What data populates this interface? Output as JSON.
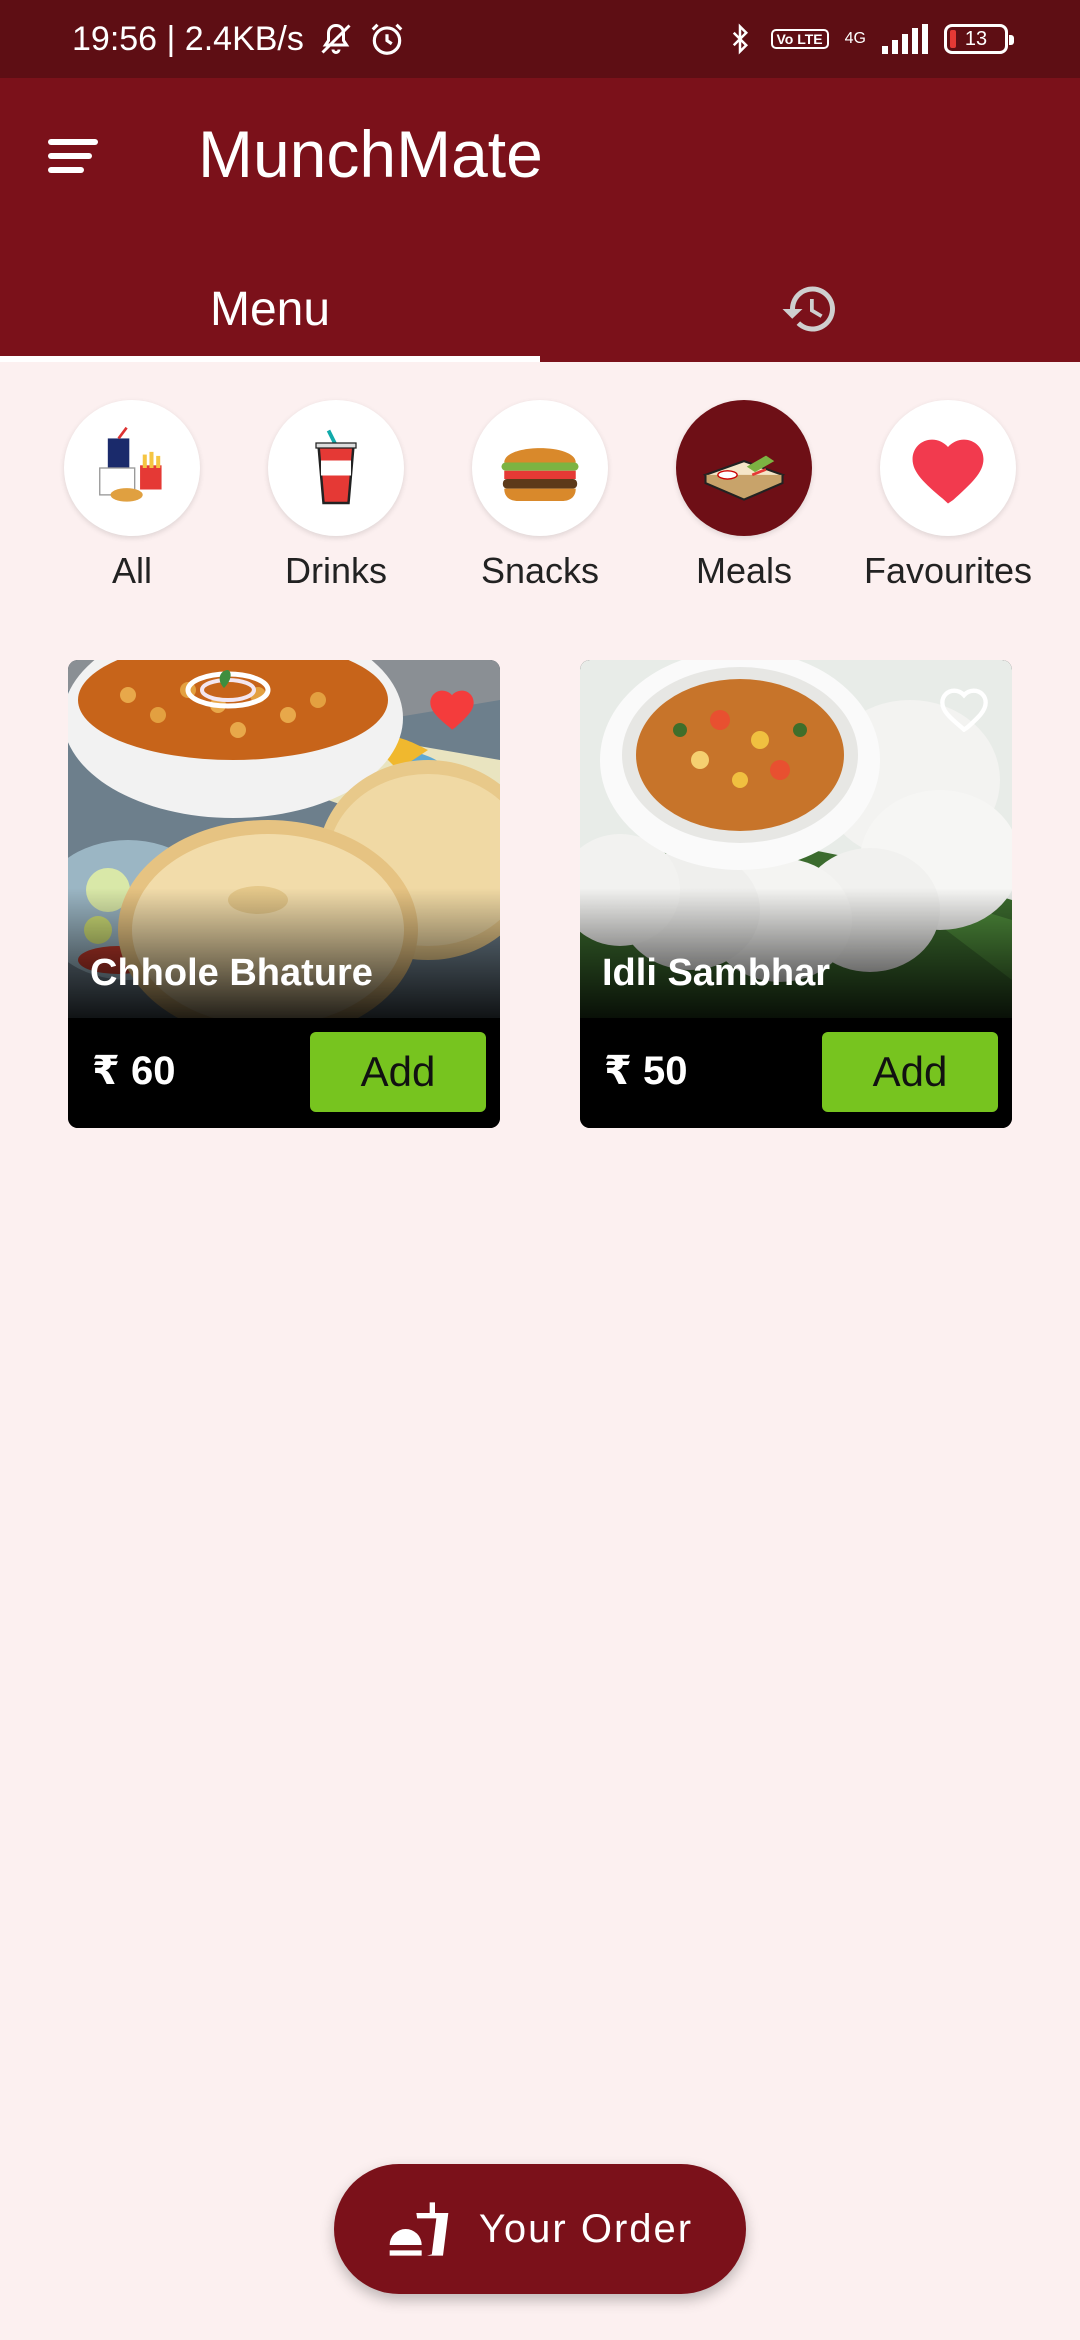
{
  "status_bar": {
    "time": "19:56 | 2.4KB/s",
    "volte": "Vo LTE",
    "network": "4G",
    "battery": "13"
  },
  "app": {
    "title": "MunchMate",
    "tabs": [
      {
        "label": "Menu",
        "selected": true
      },
      {
        "icon": "history-icon",
        "selected": false
      }
    ]
  },
  "categories": [
    {
      "label": "All",
      "icon": "combo-meal-icon",
      "selected": false
    },
    {
      "label": "Drinks",
      "icon": "soda-cup-icon",
      "selected": false
    },
    {
      "label": "Snacks",
      "icon": "burger-icon",
      "selected": false
    },
    {
      "label": "Meals",
      "icon": "meal-tray-icon",
      "selected": true
    },
    {
      "label": "Favourites",
      "icon": "heart-icon",
      "selected": false
    }
  ],
  "items": [
    {
      "name": "Chhole Bhature",
      "price": "₹ 60",
      "favourite": true,
      "add_label": "Add"
    },
    {
      "name": "Idli Sambhar",
      "price": "₹ 50",
      "favourite": false,
      "add_label": "Add"
    }
  ],
  "order_button": {
    "label": "Your Order",
    "icon": "food-order-icon"
  },
  "colors": {
    "primary": "#7b111a",
    "status_bar": "#5e0e14",
    "background": "#fcf0f0",
    "add_button": "#77c41f",
    "favourite": "#f23a4e"
  }
}
